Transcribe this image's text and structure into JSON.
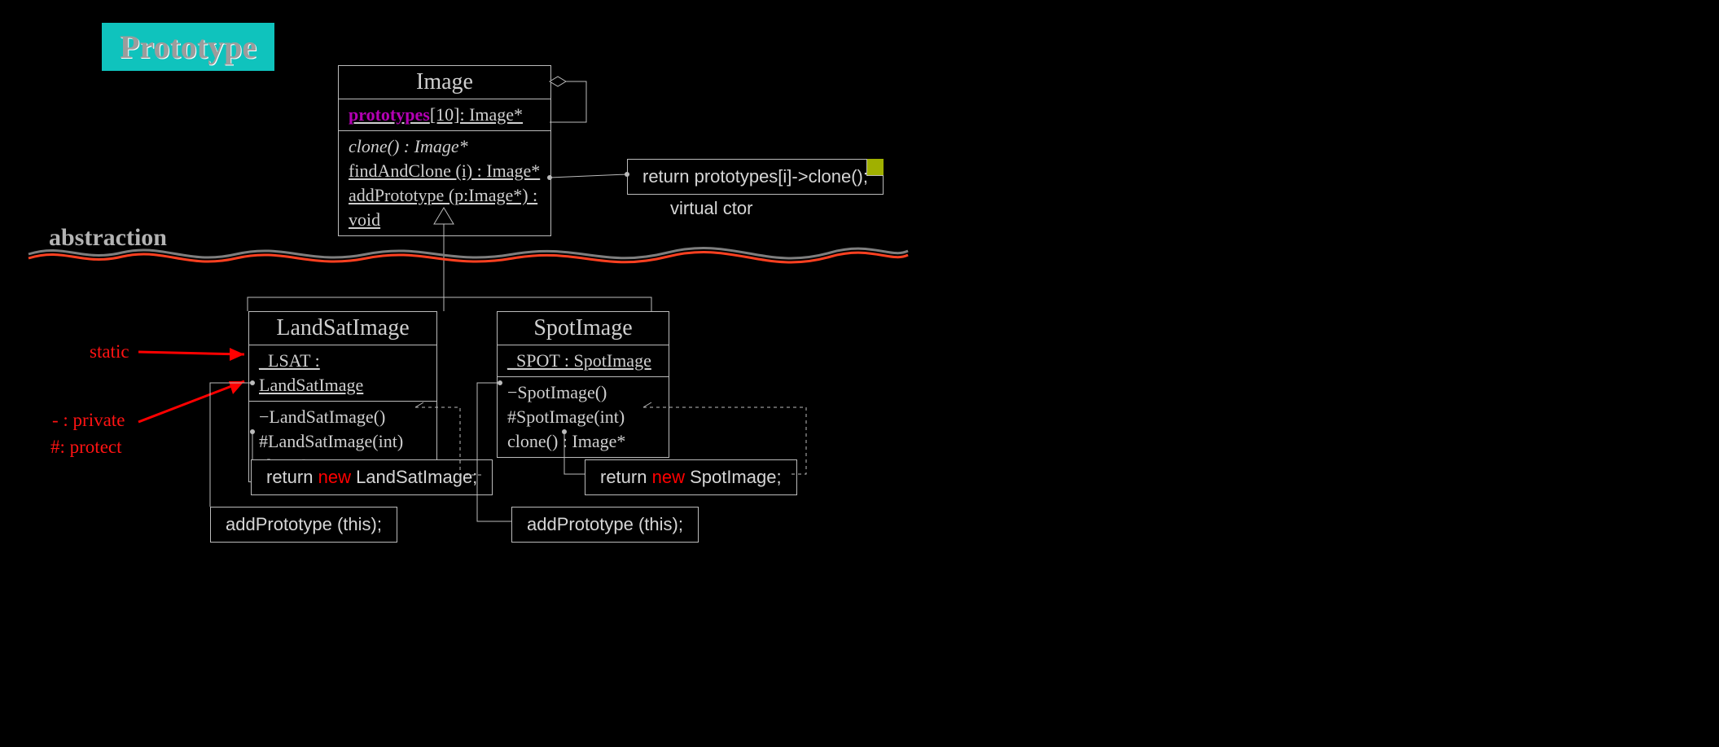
{
  "title": "Prototype",
  "abstraction_label": "abstraction",
  "image_class": {
    "name": "Image",
    "attr_prefix": "prototypes",
    "attr_suffix": "[10]: Image*",
    "op_clone": "clone() : Image*",
    "op_find": "findAndClone (i) : Image*",
    "op_add": "addPrototype (p:Image*) : void"
  },
  "note_main": {
    "body": "return prototypes[i]->clone();",
    "sub": "virtual ctor"
  },
  "landsat": {
    "name": "LandSatImage",
    "attr": "_LSAT : LandSatImage",
    "op1": "−LandSatImage()",
    "op2": "#LandSatImage(int)",
    "op3": "clone() : Image*"
  },
  "spot": {
    "name": "SpotImage",
    "attr": "_SPOT : SpotImage",
    "op1": "−SpotImage()",
    "op2": "#SpotImage(int)",
    "op3": "clone() : Image*"
  },
  "note_ls_clone": {
    "pre": "return ",
    "kw": "new",
    "post": " LandSatImage;"
  },
  "note_sp_clone": {
    "pre": "return ",
    "kw": "new",
    "post": " SpotImage;"
  },
  "note_ls_ctor": "addPrototype (this);",
  "note_sp_ctor": "addPrototype (this);",
  "ann_static": "static",
  "ann_private": "- : private",
  "ann_protect": "#: protect"
}
